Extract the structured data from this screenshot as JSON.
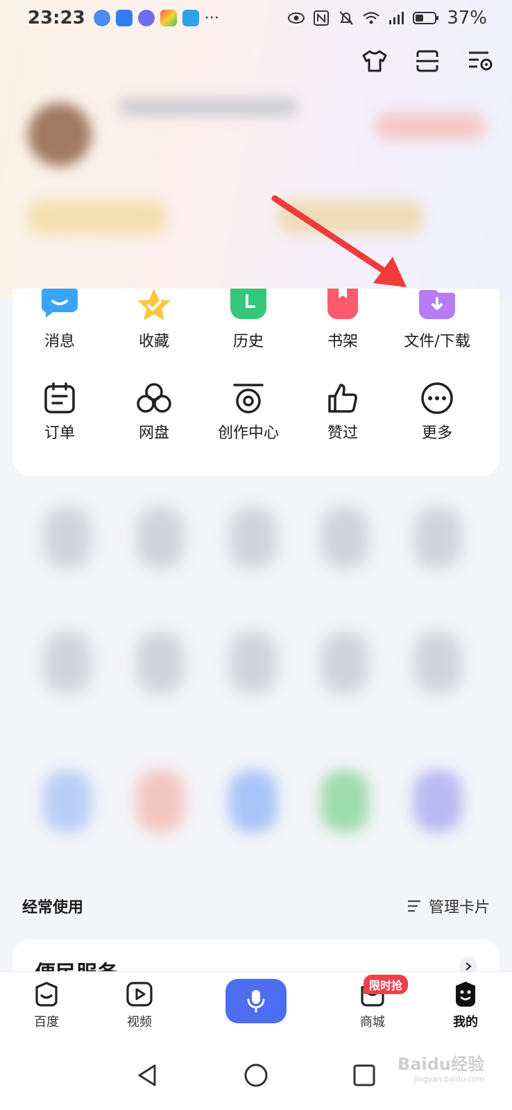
{
  "status_bar": {
    "time": "23:23",
    "more": "···",
    "battery": "37%"
  },
  "shortcuts": [
    {
      "label": "消息",
      "icon": "message-icon",
      "color": "#3aa5f8"
    },
    {
      "label": "收藏",
      "icon": "star-icon",
      "color": "#ffc53d"
    },
    {
      "label": "历史",
      "icon": "clock-icon",
      "color": "#34c77b"
    },
    {
      "label": "书架",
      "icon": "bookshelf-icon",
      "color": "#ff5a6e"
    },
    {
      "label": "文件/下载",
      "icon": "download-folder-icon",
      "color": "#b67bf5"
    }
  ],
  "tools": [
    {
      "label": "订单",
      "icon": "order-icon"
    },
    {
      "label": "网盘",
      "icon": "cloud-drive-icon"
    },
    {
      "label": "创作中心",
      "icon": "creator-center-icon"
    },
    {
      "label": "赞过",
      "icon": "thumbs-up-icon"
    },
    {
      "label": "更多",
      "icon": "more-icon"
    }
  ],
  "frequent": {
    "title": "经常使用",
    "manage": "管理卡片"
  },
  "service": {
    "title": "便民服务"
  },
  "bottom_nav": {
    "home": "百度",
    "video": "视频",
    "mall": "商城",
    "mall_badge": "限时抢",
    "mine": "我的"
  },
  "watermark": {
    "brand": "Baidu经验",
    "url": "jingyan.baidu.com"
  },
  "colors": {
    "accent": "#4e6ef2",
    "arrow": "#ef3b3b",
    "badge": "#f23d4f"
  }
}
